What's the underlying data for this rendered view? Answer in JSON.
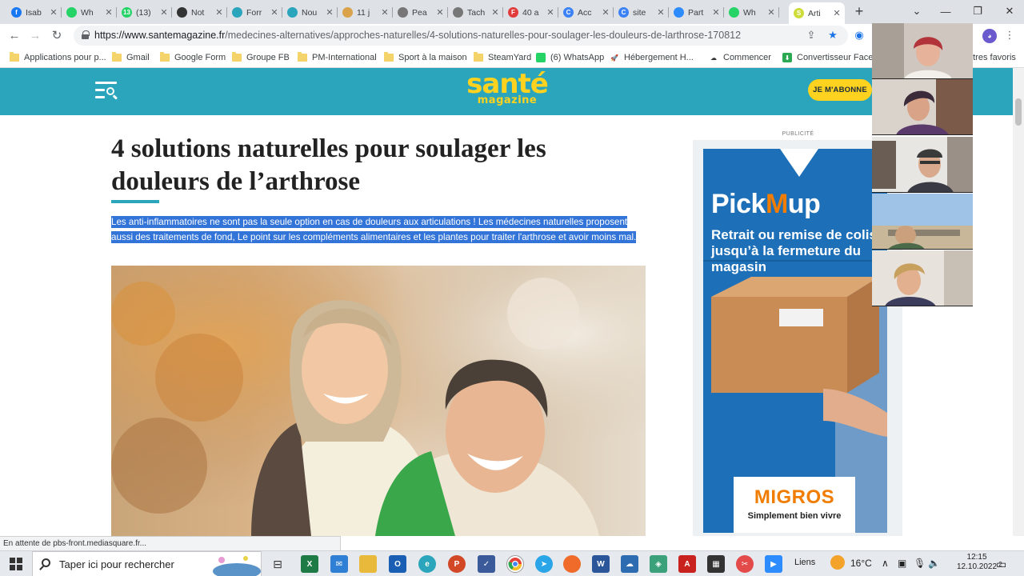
{
  "browser": {
    "tabs": [
      {
        "label": "Isab",
        "icon": "facebook-icon",
        "color": "#1877f2",
        "glyph": "f"
      },
      {
        "label": "Wh",
        "icon": "whatsapp-icon",
        "color": "#25d366",
        "glyph": ""
      },
      {
        "label": "(13)",
        "icon": "whatsapp-badge-icon",
        "color": "#25d366",
        "glyph": "13"
      },
      {
        "label": "Not",
        "icon": "github-icon",
        "color": "#333333",
        "glyph": ""
      },
      {
        "label": "Forr",
        "icon": "cloud-icon",
        "color": "#2aa5bb",
        "glyph": ""
      },
      {
        "label": "Nou",
        "icon": "cloud-icon",
        "color": "#2aa5bb",
        "glyph": ""
      },
      {
        "label": "11 j",
        "icon": "bird-icon",
        "color": "#d9a24b",
        "glyph": ""
      },
      {
        "label": "Pea",
        "icon": "grid-icon",
        "color": "#777777",
        "glyph": ""
      },
      {
        "label": "Tach",
        "icon": "grid-icon",
        "color": "#777777",
        "glyph": ""
      },
      {
        "label": "40 a",
        "icon": "f-logo-icon",
        "color": "#e23b3b",
        "glyph": "F"
      },
      {
        "label": "Acc",
        "icon": "canva-icon",
        "color": "#3b82f6",
        "glyph": "C"
      },
      {
        "label": "site",
        "icon": "canva-icon",
        "color": "#3b82f6",
        "glyph": "C"
      },
      {
        "label": "Part",
        "icon": "zoom-icon",
        "color": "#2d8cff",
        "glyph": ""
      },
      {
        "label": "Wh",
        "icon": "whatsapp-icon",
        "color": "#25d366",
        "glyph": ""
      },
      {
        "label": "Arti",
        "icon": "sante-icon",
        "color": "#cddc39",
        "glyph": "S",
        "active": true
      }
    ],
    "url_domain": "https://www.santemagazine.fr",
    "url_path": "/medecines-alternatives/approches-naturelles/4-solutions-naturelles-pour-soulager-les-douleurs-de-larthrose-170812",
    "bookmarks": [
      {
        "label": "Applications pour p...",
        "icon": "folder"
      },
      {
        "label": "Gmail",
        "icon": "folder"
      },
      {
        "label": "Google Form",
        "icon": "folder"
      },
      {
        "label": "Groupe FB",
        "icon": "folder"
      },
      {
        "label": "PM-International",
        "icon": "folder"
      },
      {
        "label": "Sport à la maison",
        "icon": "folder"
      },
      {
        "label": "SteamYard",
        "icon": "folder"
      },
      {
        "label": "(6) WhatsApp",
        "icon": "whatsapp"
      },
      {
        "label": "Hébergement H...",
        "icon": "rocket"
      },
      {
        "label": "Commencer",
        "icon": "cloud"
      },
      {
        "label": "Convertisseur Face...",
        "icon": "download"
      }
    ],
    "other_bookmarks": "utres favoris",
    "status_text": "En attente de pbs-front.mediasquare.fr..."
  },
  "site": {
    "logo_main": "santé",
    "logo_sub": "magazine",
    "subscribe_label": "JE M'ABONNE",
    "brand_color": "#2aa5bb",
    "accent_color": "#ffd21f"
  },
  "article": {
    "title": "4 solutions naturelles pour soulager les douleurs de l’arthrose",
    "lead": "Les anti-inflammatoires ne sont pas la seule option en cas de douleurs aux articulations ! Les médecines naturelles proposent aussi des traitements de fond, Le point sur les compléments alimentaires et les plantes pour traiter l'arthrose et avoir moins mal.",
    "selection_color": "#3374d8"
  },
  "ad": {
    "label": "PUBLICITÉ",
    "brand_pre": "Pick",
    "brand_m": "M",
    "brand_post": "up",
    "tagline": "Retrait ou remise de colis jusqu’à la fermeture du magasin",
    "sponsor": "MIGROS",
    "sponsor_tagline": "Simplement bien vivre"
  },
  "taskbar": {
    "search_placeholder": "Taper ici pour rechercher",
    "links_label": "Liens",
    "weather": "16°C",
    "time": "12:15",
    "date": "12.10.2022",
    "notifications": "2"
  }
}
